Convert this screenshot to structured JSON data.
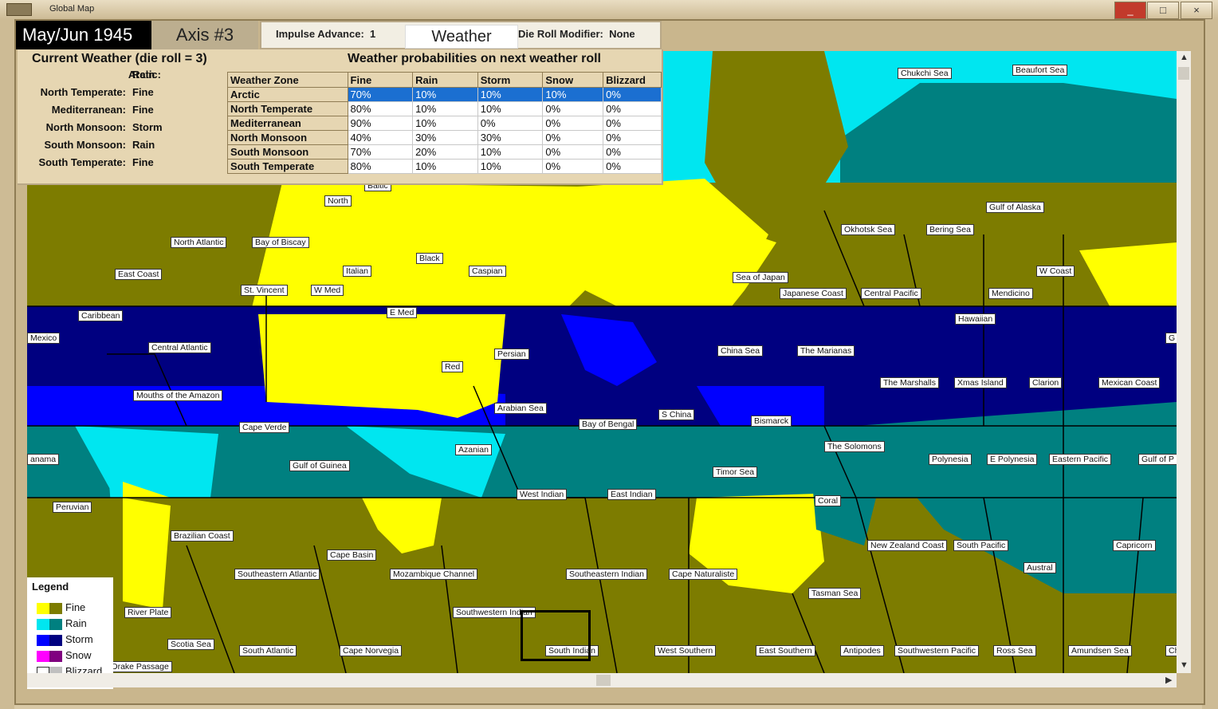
{
  "window": {
    "title": "Global Map",
    "controls": [
      "_",
      "□",
      "×"
    ]
  },
  "header": {
    "date": "May/Jun 1945",
    "side": "Axis #3",
    "impulse_label": "Impulse Advance:",
    "impulse_value": "1",
    "weather_button": "Weather",
    "die_roll_label": "Die Roll Modifier:",
    "die_roll_value": "None"
  },
  "current_weather": {
    "title": "Current Weather (die roll = 3)",
    "zones": [
      {
        "name": "Arctic:",
        "value": "Rain"
      },
      {
        "name": "North Temperate:",
        "value": "Fine"
      },
      {
        "name": "Mediterranean:",
        "value": "Fine"
      },
      {
        "name": "North Monsoon:",
        "value": "Storm"
      },
      {
        "name": "South Monsoon:",
        "value": "Rain"
      },
      {
        "name": "South Temperate:",
        "value": "Fine"
      }
    ]
  },
  "probabilities": {
    "title": "Weather probabilities on next weather roll",
    "columns": [
      "Weather Zone",
      "Fine",
      "Rain",
      "Storm",
      "Snow",
      "Blizzard"
    ],
    "rows": [
      [
        "Arctic",
        "70%",
        "10%",
        "10%",
        "10%",
        "0%"
      ],
      [
        "North Temperate",
        "80%",
        "10%",
        "10%",
        "0%",
        "0%"
      ],
      [
        "Mediterranean",
        "90%",
        "10%",
        "0%",
        "0%",
        "0%"
      ],
      [
        "North Monsoon",
        "40%",
        "30%",
        "30%",
        "0%",
        "0%"
      ],
      [
        "South Monsoon",
        "70%",
        "20%",
        "10%",
        "0%",
        "0%"
      ],
      [
        "South Temperate",
        "80%",
        "10%",
        "10%",
        "0%",
        "0%"
      ]
    ],
    "selected_row": 0
  },
  "legend": {
    "title": "Legend",
    "items": [
      {
        "label": "Fine",
        "land": "#ffff00",
        "sea": "#7d7c00"
      },
      {
        "label": "Rain",
        "land": "#00e6f0",
        "sea": "#008080"
      },
      {
        "label": "Storm",
        "land": "#0000ff",
        "sea": "#000080"
      },
      {
        "label": "Snow",
        "land": "#ff00ff",
        "sea": "#800080"
      },
      {
        "label": "Blizzard",
        "land": "#ffffff",
        "sea": "#c0c0c0"
      }
    ]
  },
  "sea_areas": [
    "Chukchi Sea",
    "Beaufort Sea",
    "Baltic",
    "North",
    "Gulf of Alaska",
    "North Atlantic",
    "Bay of Biscay",
    "Okhotsk Sea",
    "Bering Sea",
    "Black",
    "Italian",
    "Caspian",
    "East Coast",
    "W Coast",
    "Sea of Japan",
    "St. Vincent",
    "W Med",
    "Japanese Coast",
    "Central Pacific",
    "Mendicino",
    "Caribbean",
    "E Med",
    "Hawaiian",
    "Mexico",
    "Central Atlantic",
    "China Sea",
    "The Marianas",
    "Persian",
    "Red",
    "The Marshalls",
    "Xmas Island",
    "Clarion",
    "Mexican Coast",
    "Mouths of the Amazon",
    "Arabian Sea",
    "S China",
    "Bismarck",
    "Bay of Bengal",
    "Cape Verde",
    "The Solomons",
    "Azanian",
    "anama",
    "Gulf of Guinea",
    "Polynesia",
    "E Polynesia",
    "Eastern Pacific",
    "Gulf of P",
    "Timor Sea",
    "West Indian",
    "East Indian",
    "Coral",
    "Peruvian",
    "Brazilian Coast",
    "New Zealand Coast",
    "South Pacific",
    "Capricorn",
    "Cape Basin",
    "Austral",
    "Southeastern Atlantic",
    "Mozambique Channel",
    "Southeastern Indian",
    "Cape Naturaliste",
    "Tasman Sea",
    "River Plate",
    "Southwestern Indian",
    "Scotia Sea",
    "South Atlantic",
    "Cape Norvegia",
    "South Indian",
    "West Southern",
    "East Southern",
    "Antipodes",
    "Southwestern Pacific",
    "Ross Sea",
    "Amundsen Sea",
    "Drake Passage",
    "G",
    "Ch"
  ]
}
